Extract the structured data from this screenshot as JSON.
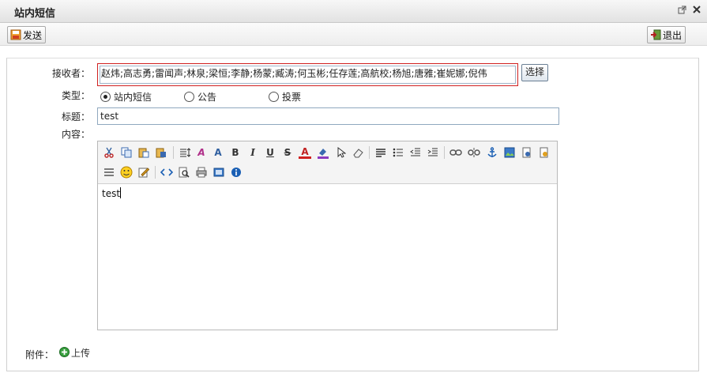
{
  "window": {
    "title": "站内短信"
  },
  "toolbar": {
    "send_label": "发送",
    "exit_label": "退出"
  },
  "form": {
    "recipient_label": "接收者：",
    "recipients_value": "赵炜;高志勇;雷闻声;林泉;梁恒;李静;杨蒙;臧涛;何玉彬;任存莲;高航校;杨旭;唐雅;崔妮娜;倪伟",
    "choose_label": "选择",
    "type_label": "类型：",
    "type_options": [
      "站内短信",
      "公告",
      "投票"
    ],
    "type_selected": "站内短信",
    "subject_label": "标题：",
    "subject_value": "test",
    "content_label": "内容：",
    "content_value": "test",
    "attachment_label": "附件：",
    "upload_label": "上传"
  },
  "colors": {
    "recipient_border": "#d02020",
    "accent_blue": "#1a5fb4"
  }
}
